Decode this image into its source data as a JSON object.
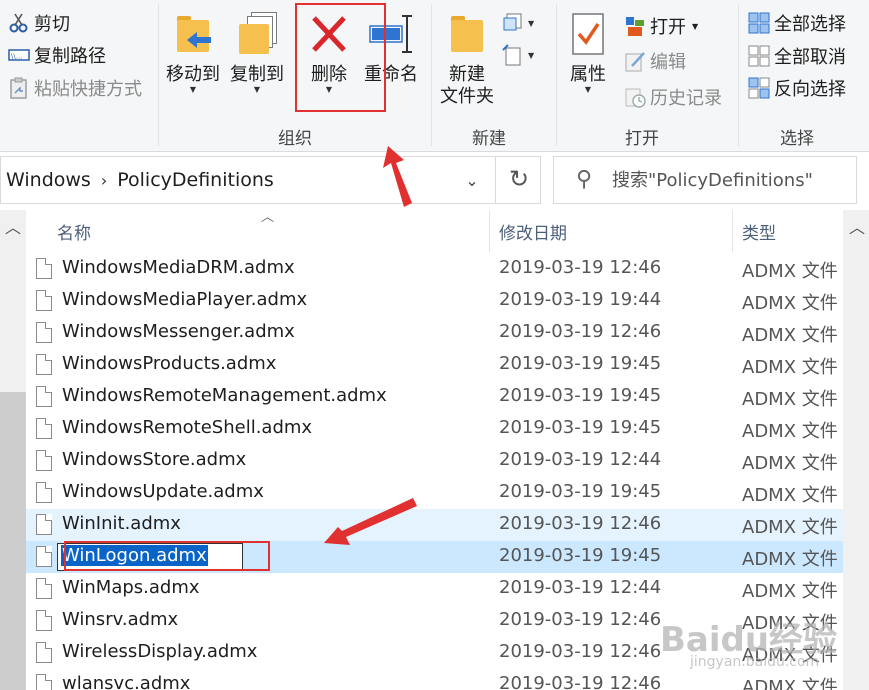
{
  "ribbon": {
    "clipboard": {
      "cut_label": "剪切",
      "copy_path_label": "复制路径",
      "paste_shortcut_label": "粘贴快捷方式"
    },
    "organize": {
      "move_to_label": "移动到",
      "copy_to_label": "复制到",
      "delete_label": "删除",
      "rename_label": "重命名",
      "group_label": "组织"
    },
    "new": {
      "new_folder_label": "新建\n文件夹",
      "new_folder_line1": "新建",
      "new_folder_line2": "文件夹",
      "group_label": "新建"
    },
    "open": {
      "properties_label": "属性",
      "open_label": "打开",
      "edit_label": "编辑",
      "history_label": "历史记录",
      "group_label": "打开"
    },
    "select": {
      "select_all_label": "全部选择",
      "select_none_label": "全部取消",
      "invert_label": "反向选择",
      "group_label": "选择"
    }
  },
  "address": {
    "crumbs": [
      "Windows",
      "PolicyDefinitions"
    ]
  },
  "search": {
    "placeholder": "搜索\"PolicyDefinitions\""
  },
  "columns": {
    "name": "名称",
    "date": "修改日期",
    "type": "类型"
  },
  "files": [
    {
      "name": "WindowsMediaDRM.admx",
      "date": "2019-03-19 12:46",
      "type": "ADMX 文件"
    },
    {
      "name": "WindowsMediaPlayer.admx",
      "date": "2019-03-19 19:44",
      "type": "ADMX 文件"
    },
    {
      "name": "WindowsMessenger.admx",
      "date": "2019-03-19 12:46",
      "type": "ADMX 文件"
    },
    {
      "name": "WindowsProducts.admx",
      "date": "2019-03-19 19:45",
      "type": "ADMX 文件"
    },
    {
      "name": "WindowsRemoteManagement.admx",
      "date": "2019-03-19 19:45",
      "type": "ADMX 文件"
    },
    {
      "name": "WindowsRemoteShell.admx",
      "date": "2019-03-19 19:45",
      "type": "ADMX 文件"
    },
    {
      "name": "WindowsStore.admx",
      "date": "2019-03-19 12:44",
      "type": "ADMX 文件"
    },
    {
      "name": "WindowsUpdate.admx",
      "date": "2019-03-19 19:45",
      "type": "ADMX 文件"
    },
    {
      "name": "WinInit.admx",
      "date": "2019-03-19 12:46",
      "type": "ADMX 文件"
    },
    {
      "name": "WinLogon.admx",
      "date": "2019-03-19 19:45",
      "type": "ADMX 文件"
    },
    {
      "name": "WinMaps.admx",
      "date": "2019-03-19 12:44",
      "type": "ADMX 文件"
    },
    {
      "name": "Winsrv.admx",
      "date": "2019-03-19 12:46",
      "type": "ADMX 文件"
    },
    {
      "name": "WirelessDisplay.admx",
      "date": "2019-03-19 12:46",
      "type": "ADMX 文件"
    },
    {
      "name": "wlansvc.admx",
      "date": "2019-03-19 12:46",
      "type": "ADMX 文件"
    }
  ],
  "selected_file_index": 9,
  "hovered_file_index": 8,
  "colors": {
    "delete_red": "#d9262b",
    "annotation_red": "#e0302f",
    "selection_bg": "#cce8ff",
    "hover_bg": "#e5f3ff",
    "rename_highlight": "#0a64c8"
  },
  "watermark": {
    "text": "Baidu经验",
    "sub": "jingyan.baidu.com"
  }
}
